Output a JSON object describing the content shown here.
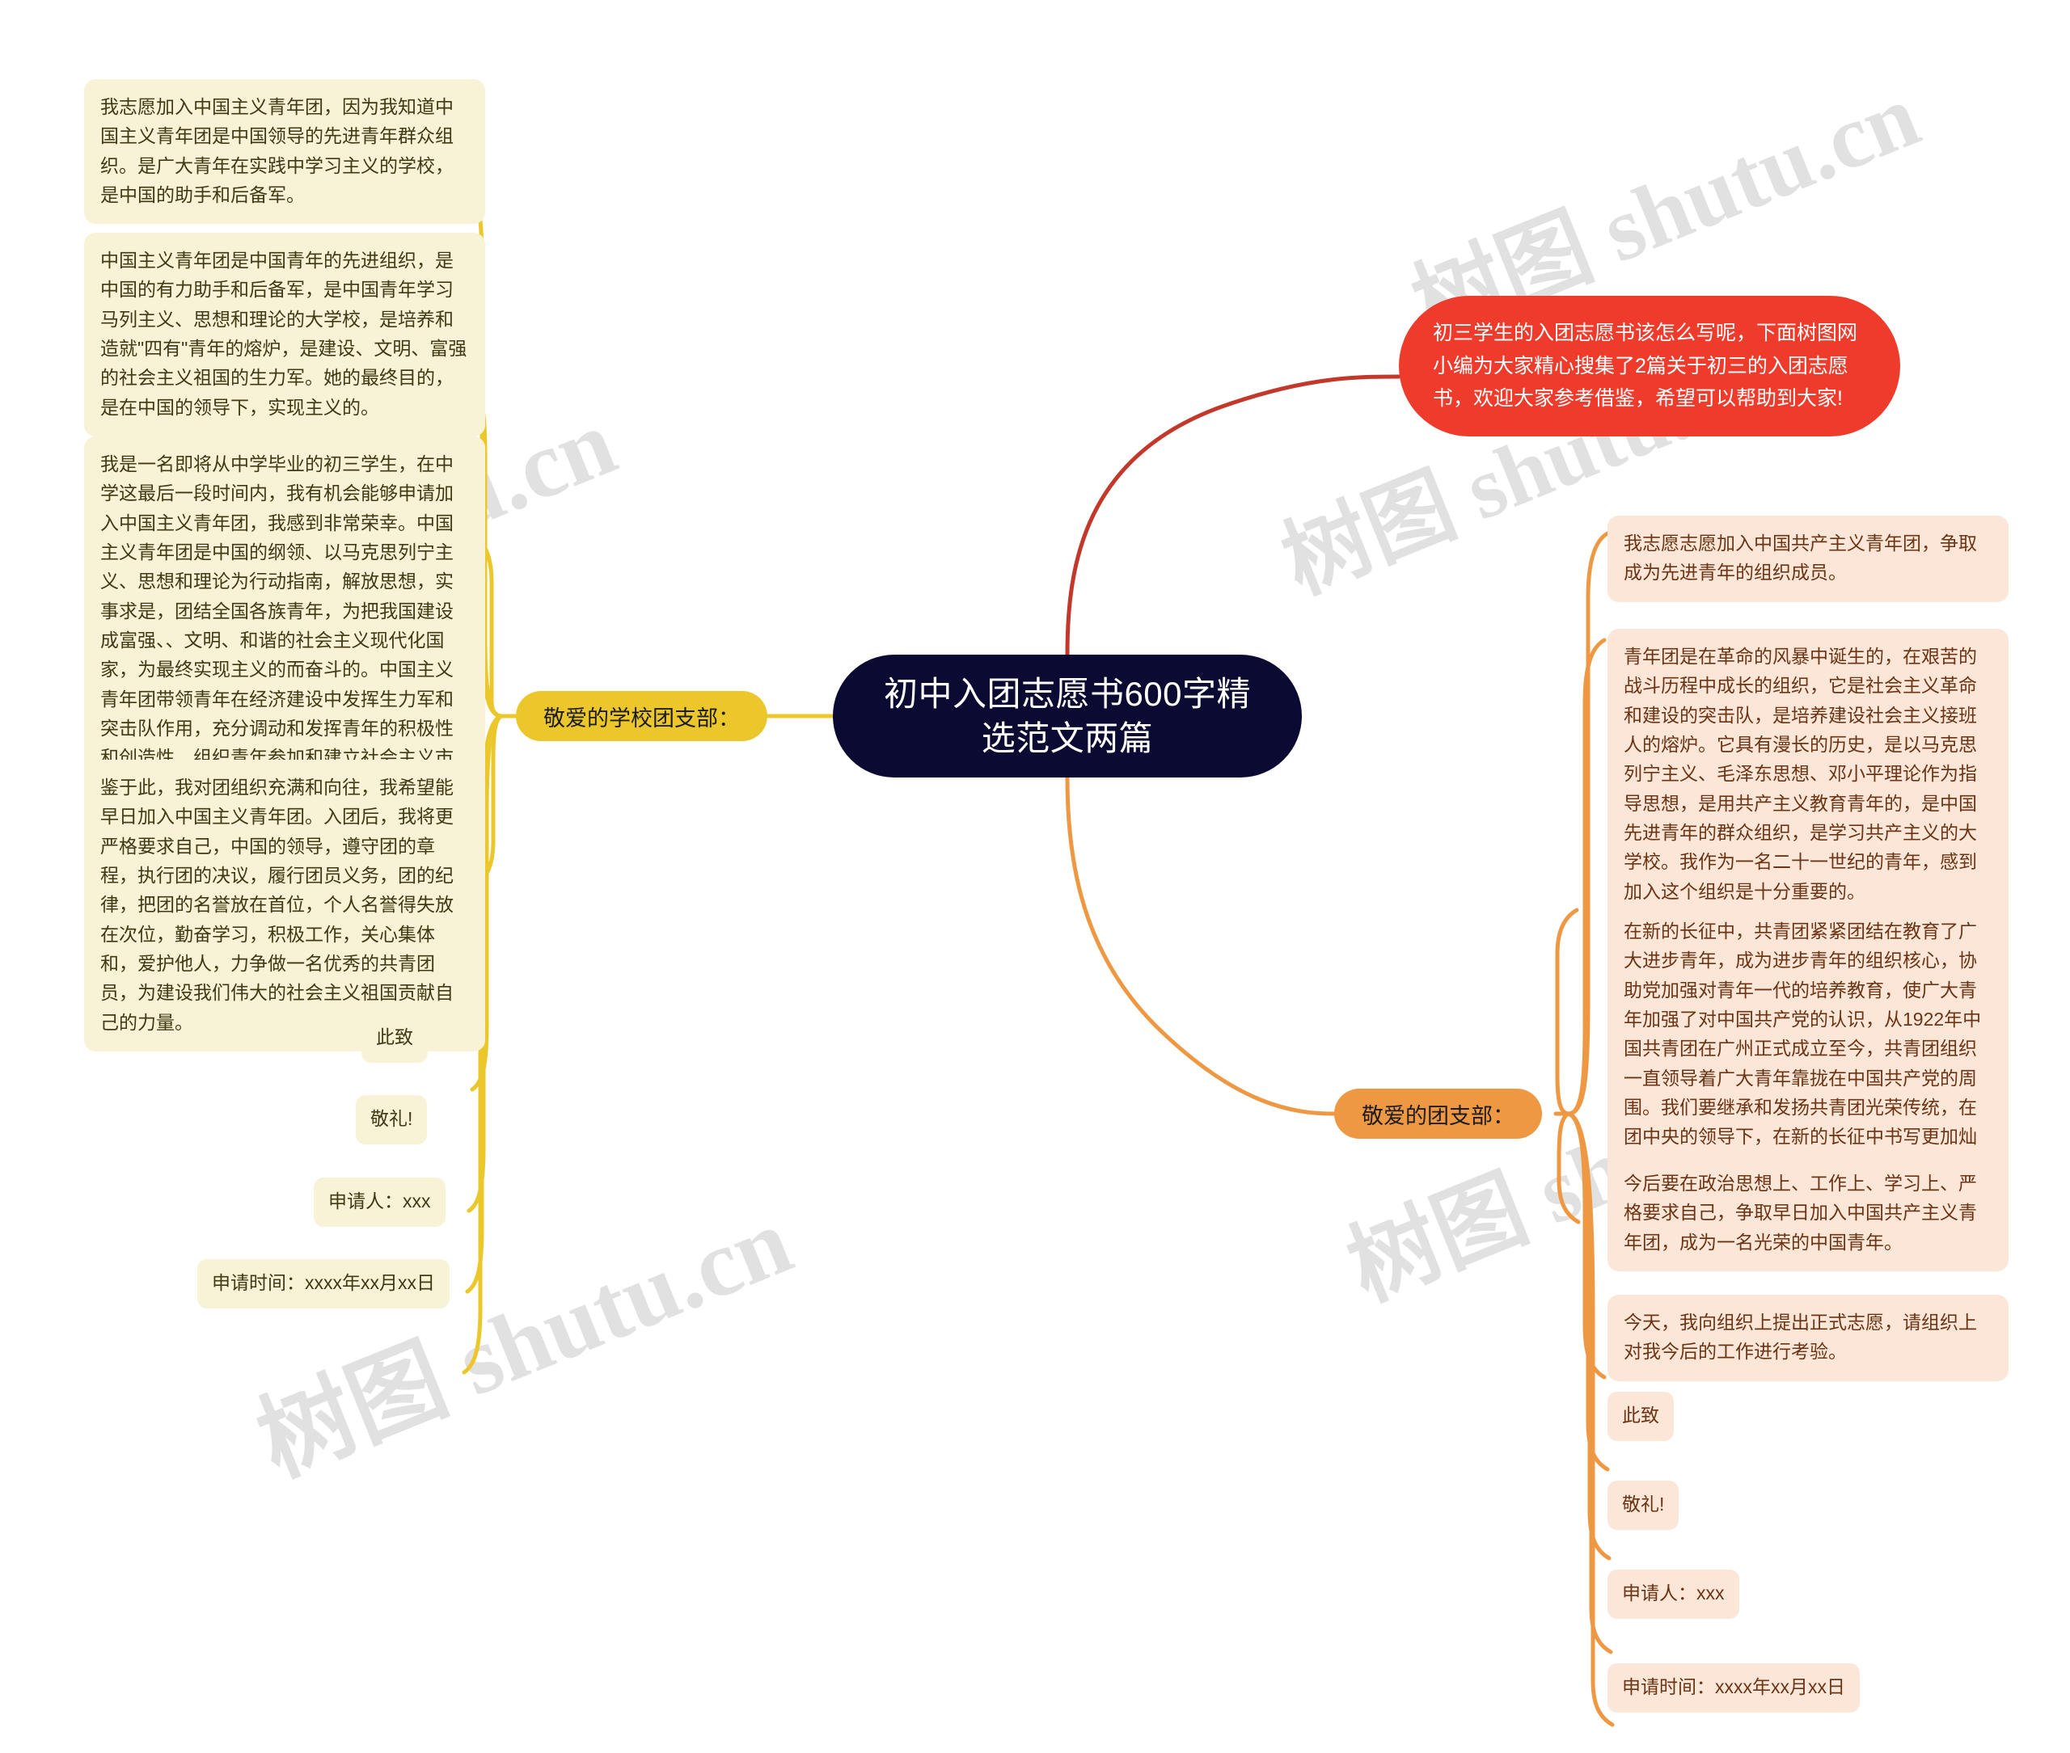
{
  "colors": {
    "root_bg": "#0a0a32",
    "root_text": "#ffffff",
    "left_branch": "#ecc72c",
    "left_leaf_bg": "#f8f2d6",
    "right_branch": "#ef9843",
    "right_leaf_bg": "#fbe6d7",
    "intro_bg": "#ee3b2b",
    "intro_link": "#c2392c",
    "watermark": "#c9c9c9"
  },
  "watermarks": [
    "shutu.cn",
    "树图 shutu.cn",
    "树图 shutu.cn",
    "树图 shutu.cn",
    "树图 shutu.cn"
  ],
  "root": {
    "title": "初中入团志愿书600字精选范文两篇"
  },
  "intro": {
    "text": "初三学生的入团志愿书该怎么写呢，下面树图网小编为大家精心搜集了2篇关于初三的入团志愿书，欢迎大家参考借鉴，希望可以帮助到大家!"
  },
  "branches": [
    {
      "id": "left-branch",
      "side": "left",
      "label": "敬爱的学校团支部：",
      "items": [
        {
          "text": "我志愿加入中国主义青年团，因为我知道中国主义青年团是中国领导的先进青年群众组织。是广大青年在实践中学习主义的学校，是中国的助手和后备军。"
        },
        {
          "text": "中国主义青年团是中国青年的先进组织，是中国的有力助手和后备军，是中国青年学习马列主义、思想和理论的大学校，是培养和造就\"四有\"青年的熔炉，是建设、文明、富强的社会主义祖国的生力军。她的最终目的，是在中国的领导下，实现主义的。"
        },
        {
          "text": "我是一名即将从中学毕业的初三学生，在中学这最后一段时间内，我有机会能够申请加入中国主义青年团，我感到非常荣幸。中国主义青年团是中国的纲领、以马克思列宁主义、思想和理论为行动指南，解放思想，实事求是，团结全国各族青年，为把我国建设成富强、、文明、和谐的社会主义现代化国家，为最终实现主义的而奋斗的。中国主义青年团带领青年在经济建设中发挥生力军和突击队作用，充分调动和发挥青年的积极性和创造性，组织青年参加和建立社会主义市场经济体制的实践。"
        },
        {
          "text": "鉴于此，我对团组织充满和向往，我希望能早日加入中国主义青年团。入团后，我将更严格要求自己，中国的领导，遵守团的章程，执行团的决议，履行团员义务，团的纪律，把团的名誉放在首位，个人名誉得失放在次位，勤奋学习，积极工作，关心集体和，爱护他人，力争做一名优秀的共青团员，为建设我们伟大的社会主义祖国贡献自己的力量。"
        },
        {
          "text": "此致"
        },
        {
          "text": "敬礼!"
        },
        {
          "text": "申请人：xxx"
        },
        {
          "text": "申请时间：xxxx年xx月xx日"
        }
      ]
    },
    {
      "id": "right-branch",
      "side": "right",
      "label": "敬爱的团支部：",
      "items": [
        {
          "text": "我志愿志愿加入中国共产主义青年团，争取成为先进青年的组织成员。"
        },
        {
          "text": "青年团是在革命的风暴中诞生的，在艰苦的战斗历程中成长的组织，它是社会主义革命和建设的突击队，是培养建设社会主义接班人的熔炉。它具有漫长的历史，是以马克思列宁主义、毛泽东思想、邓小平理论作为指导思想，是用共产主义教育青年的，是中国先进青年的群众组织，是学习共产主义的大学校。我作为一名二十一世纪的青年，感到加入这个组织是十分重要的。"
        },
        {
          "text": "在新的长征中，共青团紧紧团结在教育了广大进步青年，成为进步青年的组织核心，协助党加强对青年一代的培养教育，使广大青年加强了对中国共产党的认识，从1922年中国共青团在广州正式成立至今，共青团组织一直领导着广大青年靠拢在中国共产党的周围。我们要继承和发扬共青团光荣传统，在团中央的领导下，在新的长征中书写更加灿烂的新篇章。"
        },
        {
          "text": "今后要在政治思想上、工作上、学习上、严格要求自己，争取早日加入中国共产主义青年团，成为一名光荣的中国青年。"
        },
        {
          "text": "今天，我向组织上提出正式志愿，请组织上对我今后的工作进行考验。"
        },
        {
          "text": "此致"
        },
        {
          "text": "敬礼!"
        },
        {
          "text": "申请人：xxx"
        },
        {
          "text": "申请时间：xxxx年xx月xx日"
        }
      ]
    }
  ]
}
